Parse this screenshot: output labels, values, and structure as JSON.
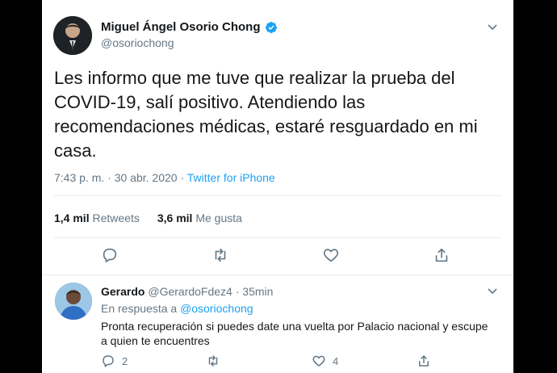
{
  "tweet": {
    "author_name": "Miguel Ángel Osorio Chong",
    "author_handle": "@osoriochong",
    "text": "Les informo que me tuve que realizar la prueba del COVID-19, salí positivo. Atendiendo las recomendaciones médicas, estaré resguardado en mi casa.",
    "time": "7:43 p. m.",
    "separator": "·",
    "date": "30 abr. 2020",
    "source": "Twitter for iPhone",
    "retweets_count": "1,4 mil",
    "retweets_label": "Retweets",
    "likes_count": "3,6 mil",
    "likes_label": "Me gusta"
  },
  "reply": {
    "author_name": "Gerardo",
    "author_handle": "@GerardoFdez4",
    "separator": "·",
    "age": "35min",
    "in_reply_prefix": "En respuesta a",
    "in_reply_mention": "@osoriochong",
    "text": "Pronta recuperación si puedes date una vuelta por Palacio nacional y escupe a quien te encuentres",
    "replies_count": "2",
    "likes_count": "4"
  },
  "icons": {
    "verified": "verified-badge-icon",
    "chevron": "chevron-down-icon",
    "reply": "reply-icon",
    "retweet": "retweet-icon",
    "like": "heart-icon",
    "share": "share-icon"
  },
  "colors": {
    "accent": "#1da1f2",
    "muted": "#657786",
    "text": "#14171a",
    "divider": "#e6ecf0"
  }
}
